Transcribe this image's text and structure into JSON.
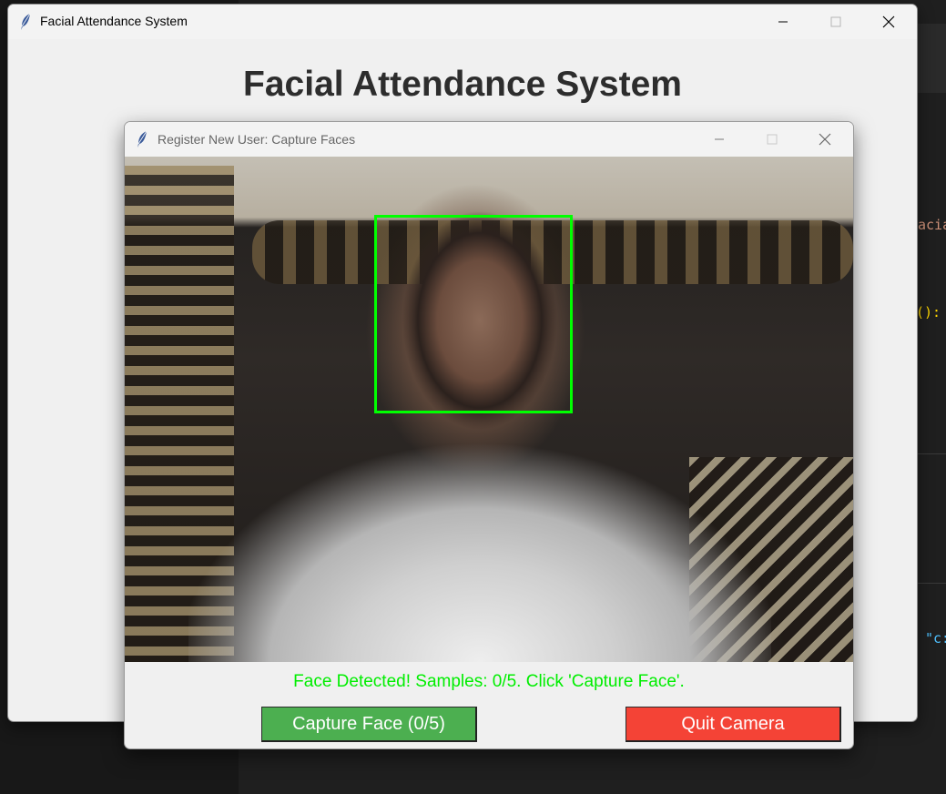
{
  "main_window": {
    "title": "Facial Attendance System",
    "heading": "Facial Attendance System"
  },
  "dialog": {
    "title": "Register New User: Capture Faces",
    "status": "Face Detected! Samples: 0/5. Click 'Capture Face'.",
    "capture_button": "Capture Face (0/5)",
    "quit_button": "Quit Camera",
    "face_box_color": "#00ff00",
    "status_color": "#00ee00",
    "capture_color": "#4caf50",
    "quit_color": "#f44336"
  },
  "background_editor": {
    "code_fragment_1": "acia",
    "code_fragment_2": "():",
    "code_fragment_3": "\"c:"
  },
  "icons": {
    "app_icon": "feather-icon",
    "minimize": "minimize-icon",
    "maximize": "maximize-icon",
    "close": "close-icon"
  }
}
